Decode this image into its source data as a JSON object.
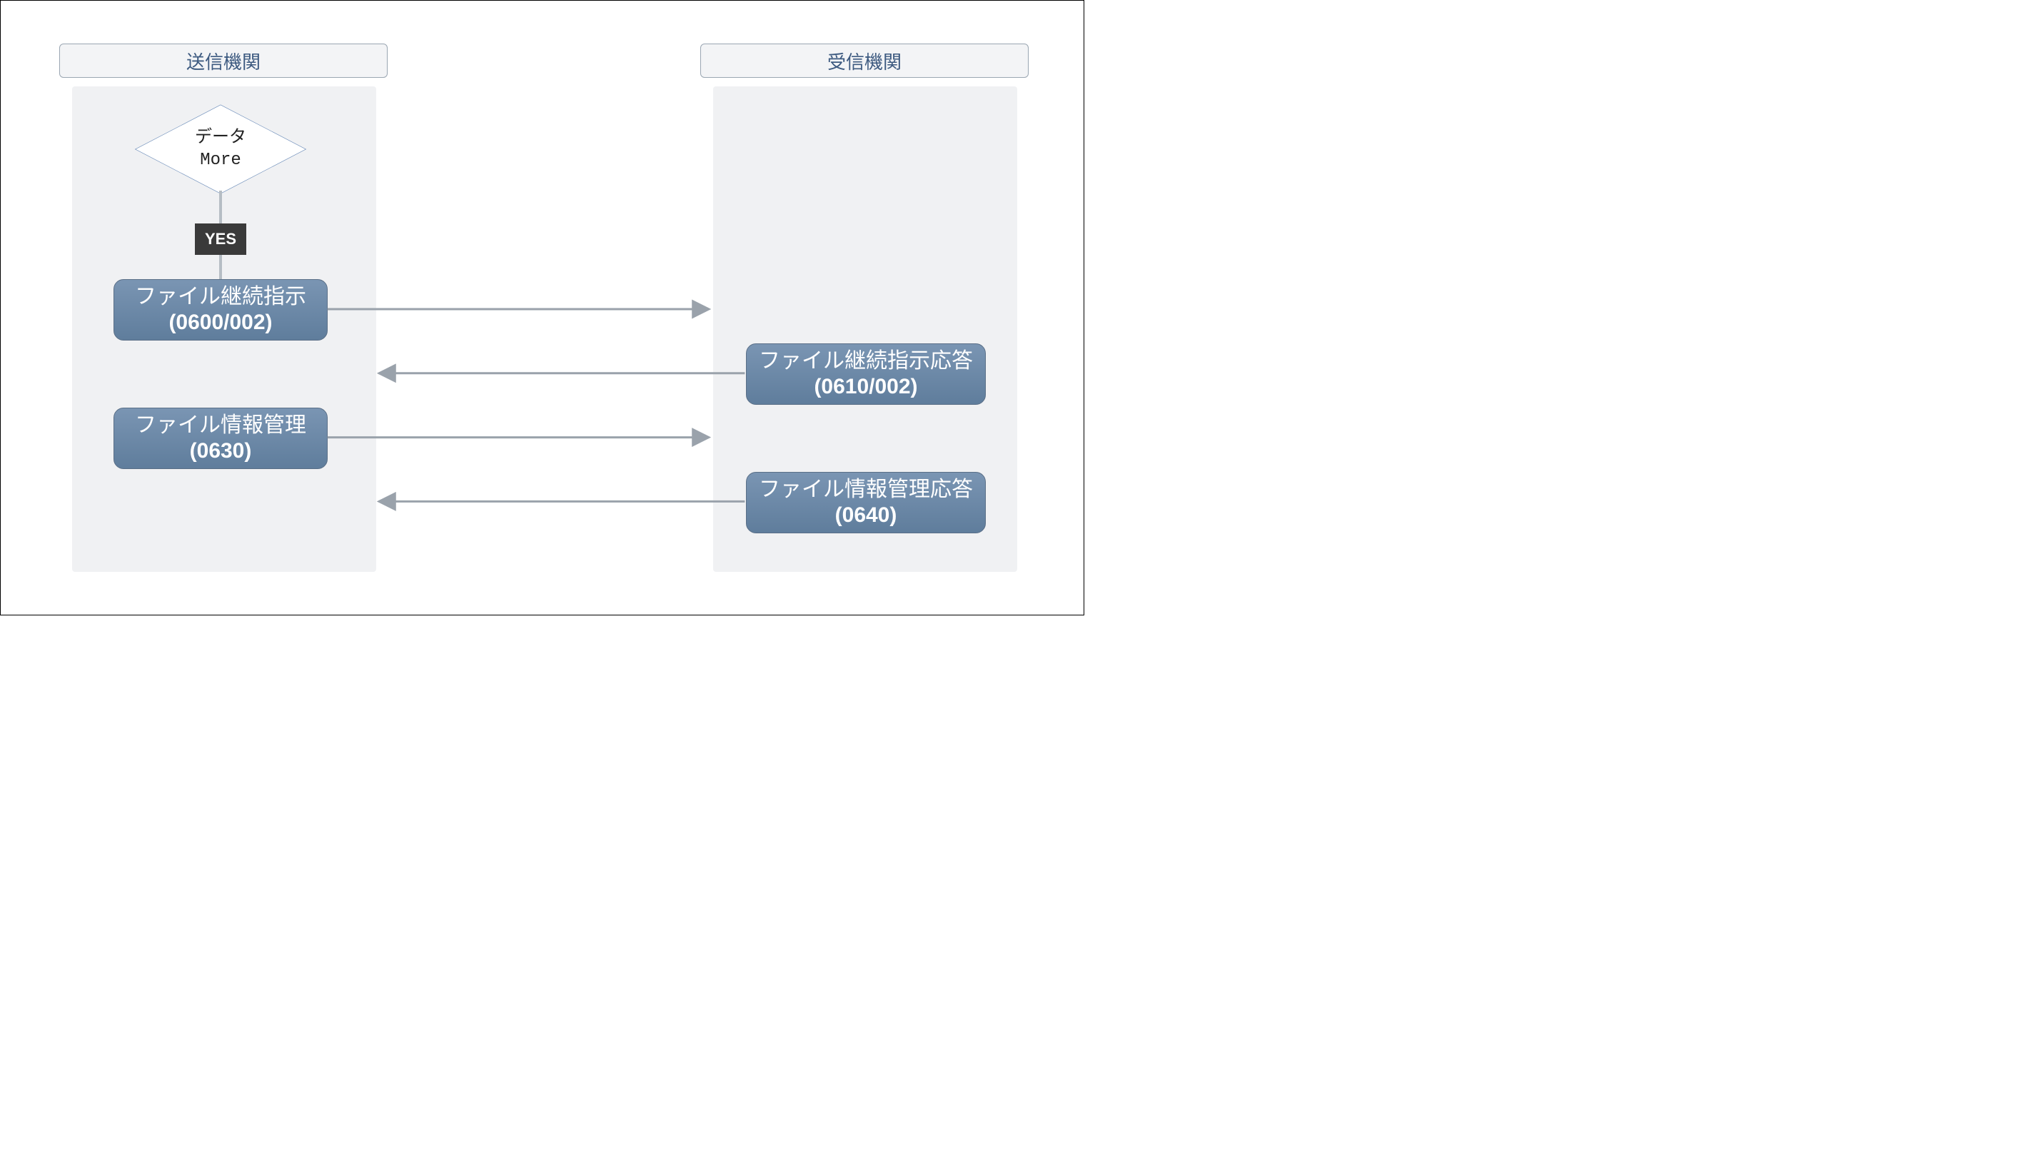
{
  "headers": {
    "sender": "送信機関",
    "receiver": "受信機関"
  },
  "decision": {
    "line1": "データ",
    "line2": "More"
  },
  "yes_label": "YES",
  "nodes": {
    "file_continue_instruction": {
      "title": "ファイル継続指示",
      "code": "(0600/002)"
    },
    "file_continue_response": {
      "title": "ファイル継続指示応答",
      "code": "(0610/002)"
    },
    "file_info_mgmt": {
      "title": "ファイル情報管理",
      "code": "(0630)"
    },
    "file_info_mgmt_response": {
      "title": "ファイル情報管理応答",
      "code": "(0640)"
    }
  },
  "colors": {
    "header_text": "#3d5a80",
    "node_fill_top": "#7a95b3",
    "node_fill_bottom": "#5f7d9c",
    "lane_bg": "#f0f1f3",
    "arrow": "#9aa2ab",
    "yes_bg": "#3a3a3a"
  }
}
